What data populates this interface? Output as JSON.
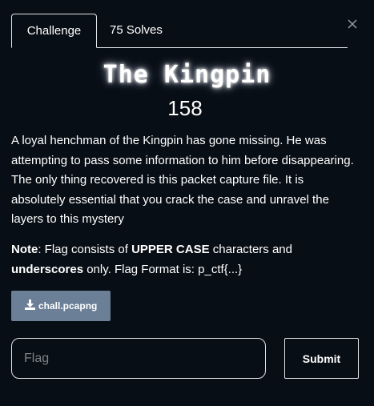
{
  "tabs": [
    {
      "label": "Challenge",
      "active": true
    },
    {
      "label": "75 Solves",
      "active": false
    }
  ],
  "challenge": {
    "name": "The Kingpin",
    "points": "158",
    "description": "A loyal henchman of the Kingpin has gone missing. He was attempting to pass some information to him before disappearing. The only thing recovered is this packet capture file. It is absolutely essential that you crack the case and unravel the layers to this mystery",
    "note": {
      "label": "Note",
      "t1": ": Flag consists of ",
      "b1": "UPPER CASE",
      "t2": " characters and ",
      "b2": "underscores",
      "t3": " only. Flag Format is: p_ctf{...}"
    },
    "file": {
      "name": "chall.pcapng",
      "icon": "download-icon"
    }
  },
  "form": {
    "flag_placeholder": "Flag",
    "flag_value": "",
    "submit_label": "Submit"
  },
  "icons": {
    "close": "close-icon"
  },
  "colors": {
    "background": "#080e15",
    "text": "#ffffff",
    "border": "#dfe3e7",
    "file_button": "#6b7f96",
    "placeholder": "#7d8388"
  }
}
